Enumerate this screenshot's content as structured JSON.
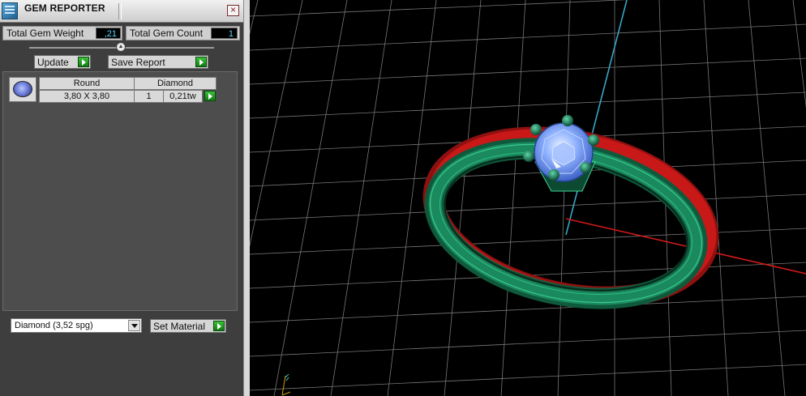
{
  "window": {
    "title": "GEM REPORTER",
    "close_glyph": "×"
  },
  "stats": {
    "weight_label": "Total Gem Weight",
    "weight_value": ",21",
    "count_label": "Total Gem Count",
    "count_value": "1"
  },
  "toolbar": {
    "update_label": "Update",
    "save_label": "Save Report"
  },
  "gems": [
    {
      "shape": "Round",
      "size": "3,80 X 3,80",
      "material": "Diamond",
      "count": "1",
      "weight": "0,21tw"
    }
  ],
  "material_select": {
    "value": "Diamond     (3,52 spg)"
  },
  "set_material_label": "Set Material",
  "icons": {
    "app": "gem-reporter-app-icon",
    "close": "close-icon",
    "go": "green-arrow-icon",
    "gem": "round-gem-icon",
    "dropdown": "chevron-down-icon"
  },
  "colors": {
    "panel_bg": "#3e3e3e",
    "value_text": "#54d9ff",
    "go_green": "#1e9e1e",
    "ring_green": "#1a8a5e",
    "ring_red": "#c81818",
    "axis_red": "#d01818",
    "axis_cyan": "#38a6c8"
  }
}
